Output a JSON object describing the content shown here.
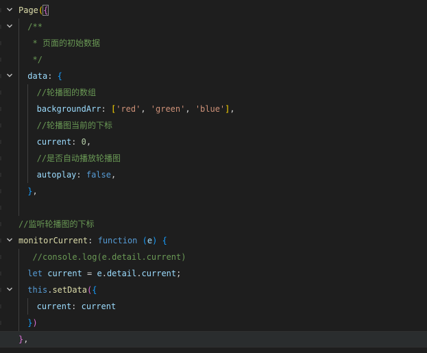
{
  "editor": {
    "lines": [
      {
        "fold": true,
        "indent": 0,
        "tokens": [
          {
            "t": "Page",
            "c": "tok-fn"
          },
          {
            "t": "(",
            "c": "tok-brace"
          },
          {
            "t": "{",
            "c": "tok-paren2 bracket-box"
          }
        ]
      },
      {
        "fold": true,
        "indent": 1,
        "tokens": [
          {
            "t": "/**",
            "c": "tok-com"
          }
        ]
      },
      {
        "fold": false,
        "indent": 1,
        "tokens": [
          {
            "t": " * 页面的初始数据",
            "c": "tok-com"
          }
        ]
      },
      {
        "fold": false,
        "indent": 1,
        "tokens": [
          {
            "t": " */",
            "c": "tok-com"
          }
        ]
      },
      {
        "fold": true,
        "indent": 1,
        "tokens": [
          {
            "t": "data",
            "c": "tok-prop"
          },
          {
            "t": ": ",
            "c": "tok-punc"
          },
          {
            "t": "{",
            "c": "tok-paren3"
          }
        ]
      },
      {
        "fold": false,
        "indent": 2,
        "tokens": [
          {
            "t": "//轮播图的数组",
            "c": "tok-com"
          }
        ]
      },
      {
        "fold": false,
        "indent": 2,
        "tokens": [
          {
            "t": "backgroundArr",
            "c": "tok-prop"
          },
          {
            "t": ": ",
            "c": "tok-punc"
          },
          {
            "t": "[",
            "c": "tok-brace"
          },
          {
            "t": "'red'",
            "c": "tok-str"
          },
          {
            "t": ", ",
            "c": "tok-punc"
          },
          {
            "t": "'green'",
            "c": "tok-str"
          },
          {
            "t": ", ",
            "c": "tok-punc"
          },
          {
            "t": "'blue'",
            "c": "tok-str"
          },
          {
            "t": "]",
            "c": "tok-brace"
          },
          {
            "t": ",",
            "c": "tok-punc"
          }
        ]
      },
      {
        "fold": false,
        "indent": 2,
        "tokens": [
          {
            "t": "//轮播图当前的下标",
            "c": "tok-com"
          }
        ]
      },
      {
        "fold": false,
        "indent": 2,
        "tokens": [
          {
            "t": "current",
            "c": "tok-prop"
          },
          {
            "t": ": ",
            "c": "tok-punc"
          },
          {
            "t": "0",
            "c": "tok-num"
          },
          {
            "t": ",",
            "c": "tok-punc"
          }
        ]
      },
      {
        "fold": false,
        "indent": 2,
        "tokens": [
          {
            "t": "//是否自动播放轮播图",
            "c": "tok-com"
          }
        ]
      },
      {
        "fold": false,
        "indent": 2,
        "tokens": [
          {
            "t": "autoplay",
            "c": "tok-prop"
          },
          {
            "t": ": ",
            "c": "tok-punc"
          },
          {
            "t": "false",
            "c": "tok-kw"
          },
          {
            "t": ",",
            "c": "tok-punc"
          }
        ]
      },
      {
        "fold": false,
        "indent": 1,
        "tokens": [
          {
            "t": "}",
            "c": "tok-paren3"
          },
          {
            "t": ",",
            "c": "tok-punc"
          }
        ]
      },
      {
        "fold": false,
        "indent": 1,
        "tokens": []
      },
      {
        "fold": false,
        "indent": 0,
        "tokens": [
          {
            "t": "//监听轮播图的下标",
            "c": "tok-com"
          }
        ]
      },
      {
        "fold": true,
        "indent": 0,
        "tokens": [
          {
            "t": "monitorCurrent",
            "c": "tok-fn"
          },
          {
            "t": ": ",
            "c": "tok-punc"
          },
          {
            "t": "function",
            "c": "tok-kw"
          },
          {
            "t": " ",
            "c": "tok-punc"
          },
          {
            "t": "(",
            "c": "tok-paren3"
          },
          {
            "t": "e",
            "c": "tok-var"
          },
          {
            "t": ")",
            "c": "tok-paren3"
          },
          {
            "t": " ",
            "c": "tok-punc"
          },
          {
            "t": "{",
            "c": "tok-paren3"
          }
        ]
      },
      {
        "fold": false,
        "indent": 1,
        "tokens": [
          {
            "t": " //console.log(e.detail.current)",
            "c": "tok-com"
          }
        ]
      },
      {
        "fold": false,
        "indent": 1,
        "tokens": [
          {
            "t": "let",
            "c": "tok-kw"
          },
          {
            "t": " ",
            "c": "tok-punc"
          },
          {
            "t": "current",
            "c": "tok-var"
          },
          {
            "t": " = ",
            "c": "tok-punc"
          },
          {
            "t": "e",
            "c": "tok-var"
          },
          {
            "t": ".",
            "c": "tok-punc"
          },
          {
            "t": "detail",
            "c": "tok-var"
          },
          {
            "t": ".",
            "c": "tok-punc"
          },
          {
            "t": "current",
            "c": "tok-var"
          },
          {
            "t": ";",
            "c": "tok-punc"
          }
        ]
      },
      {
        "fold": true,
        "indent": 1,
        "tokens": [
          {
            "t": "this",
            "c": "tok-kw"
          },
          {
            "t": ".",
            "c": "tok-punc"
          },
          {
            "t": "setData",
            "c": "tok-fn"
          },
          {
            "t": "(",
            "c": "tok-paren2"
          },
          {
            "t": "{",
            "c": "tok-paren3"
          }
        ]
      },
      {
        "fold": false,
        "indent": 2,
        "tokens": [
          {
            "t": "current",
            "c": "tok-prop"
          },
          {
            "t": ": ",
            "c": "tok-punc"
          },
          {
            "t": "current",
            "c": "tok-var"
          }
        ]
      },
      {
        "fold": false,
        "indent": 1,
        "tokens": [
          {
            "t": "}",
            "c": "tok-paren3"
          },
          {
            "t": ")",
            "c": "tok-paren2"
          }
        ]
      },
      {
        "fold": false,
        "indent": 0,
        "current": true,
        "tokens": [
          {
            "t": "}",
            "c": "tok-paren2"
          },
          {
            "t": ",",
            "c": "tok-punc"
          }
        ]
      }
    ]
  }
}
